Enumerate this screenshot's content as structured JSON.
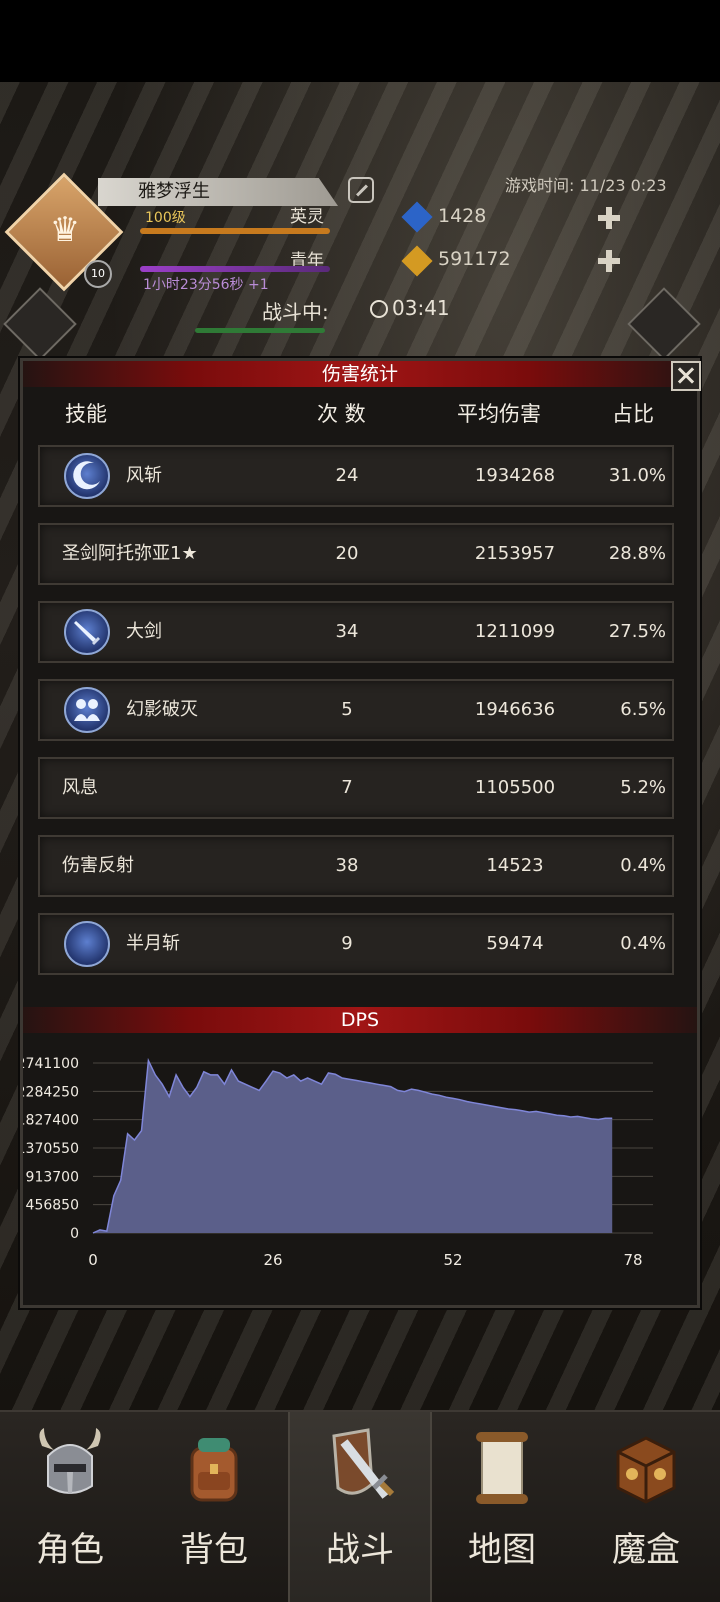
{
  "header": {
    "player_name": "雅梦浮生",
    "level": "100级",
    "rank": "英灵",
    "level_badge": "10",
    "age_label": "青年",
    "game_time": "游戏时间: 11/23 0:23",
    "blue_gem_count": "1428",
    "gold_count": "591172",
    "timer": "1小时23分56秒 +1",
    "battle_status": "战斗中:",
    "battle_timer": "03:41"
  },
  "damage_stats": {
    "title": "伤害统计",
    "columns": [
      "技能",
      "次 数",
      "平均伤害",
      "占比"
    ],
    "rows": [
      {
        "skill": "风斩",
        "icon": "wind-slash-icon",
        "count": "24",
        "avg": "1934268",
        "pct": "31.0%"
      },
      {
        "skill": "圣剑阿托弥亚1★",
        "icon": "",
        "count": "20",
        "avg": "2153957",
        "pct": "28.8%"
      },
      {
        "skill": "大剑",
        "icon": "greatsword-icon",
        "count": "34",
        "avg": "1211099",
        "pct": "27.5%"
      },
      {
        "skill": "幻影破灭",
        "icon": "phantom-icon",
        "count": "5",
        "avg": "1946636",
        "pct": "6.5%"
      },
      {
        "skill": "风息",
        "icon": "",
        "count": "7",
        "avg": "1105500",
        "pct": "5.2%"
      },
      {
        "skill": "伤害反射",
        "icon": "",
        "count": "38",
        "avg": "14523",
        "pct": "0.4%"
      },
      {
        "skill": "半月斩",
        "icon": "half-moon-slash-icon",
        "count": "9",
        "avg": "59474",
        "pct": "0.4%"
      }
    ]
  },
  "chart_data": {
    "type": "area",
    "title": "DPS",
    "xlabel": "",
    "ylabel": "",
    "xlim": [
      0,
      78
    ],
    "ylim": [
      0,
      2741100
    ],
    "x_ticks": [
      "0",
      "26",
      "52",
      "78"
    ],
    "y_ticks": [
      "2741100",
      "2284250",
      "1827400",
      "1370550",
      "913700",
      "456850",
      "0"
    ],
    "grid": true,
    "color": "#5b5f8a",
    "line_color": "#7f86d8",
    "x": [
      0,
      1,
      2,
      3,
      4,
      5,
      6,
      7,
      8,
      9,
      10,
      11,
      12,
      13,
      14,
      15,
      16,
      17,
      18,
      19,
      20,
      21,
      22,
      23,
      24,
      25,
      26,
      27,
      28,
      29,
      30,
      31,
      32,
      33,
      34,
      35,
      36,
      37,
      38,
      39,
      40,
      41,
      42,
      43,
      44,
      45,
      46,
      47,
      48,
      49,
      50,
      51,
      52,
      53,
      54,
      55,
      56,
      57,
      58,
      59,
      60,
      61,
      62,
      63,
      64,
      65,
      66,
      67,
      68,
      69,
      70,
      71,
      72,
      73,
      74,
      75
    ],
    "values": [
      0,
      50000,
      30000,
      600000,
      850000,
      1600000,
      1500000,
      1650000,
      2780000,
      2550000,
      2400000,
      2200000,
      2550000,
      2350000,
      2200000,
      2350000,
      2600000,
      2550000,
      2550000,
      2400000,
      2630000,
      2450000,
      2400000,
      2350000,
      2300000,
      2450000,
      2610000,
      2580000,
      2500000,
      2550000,
      2450000,
      2500000,
      2450000,
      2400000,
      2580000,
      2560000,
      2500000,
      2480000,
      2460000,
      2440000,
      2420000,
      2400000,
      2380000,
      2360000,
      2300000,
      2280000,
      2320000,
      2300000,
      2270000,
      2240000,
      2220000,
      2190000,
      2170000,
      2150000,
      2120000,
      2100000,
      2080000,
      2060000,
      2040000,
      2020000,
      2000000,
      1990000,
      1970000,
      1950000,
      1960000,
      1940000,
      1920000,
      1900000,
      1890000,
      1870000,
      1880000,
      1860000,
      1840000,
      1830000,
      1850000,
      1850000
    ]
  },
  "nav": {
    "tabs": [
      {
        "label": "角色",
        "icon": "helmet-icon"
      },
      {
        "label": "背包",
        "icon": "backpack-icon"
      },
      {
        "label": "战斗",
        "icon": "shield-sword-icon"
      },
      {
        "label": "地图",
        "icon": "scroll-map-icon"
      },
      {
        "label": "魔盒",
        "icon": "magic-box-icon"
      }
    ],
    "active": "战斗"
  },
  "colors": {
    "banner_red": "#a01515",
    "chart_fill": "#5b5f8a",
    "chart_line": "#7f86d8",
    "gold_text": "#e9c65a"
  }
}
